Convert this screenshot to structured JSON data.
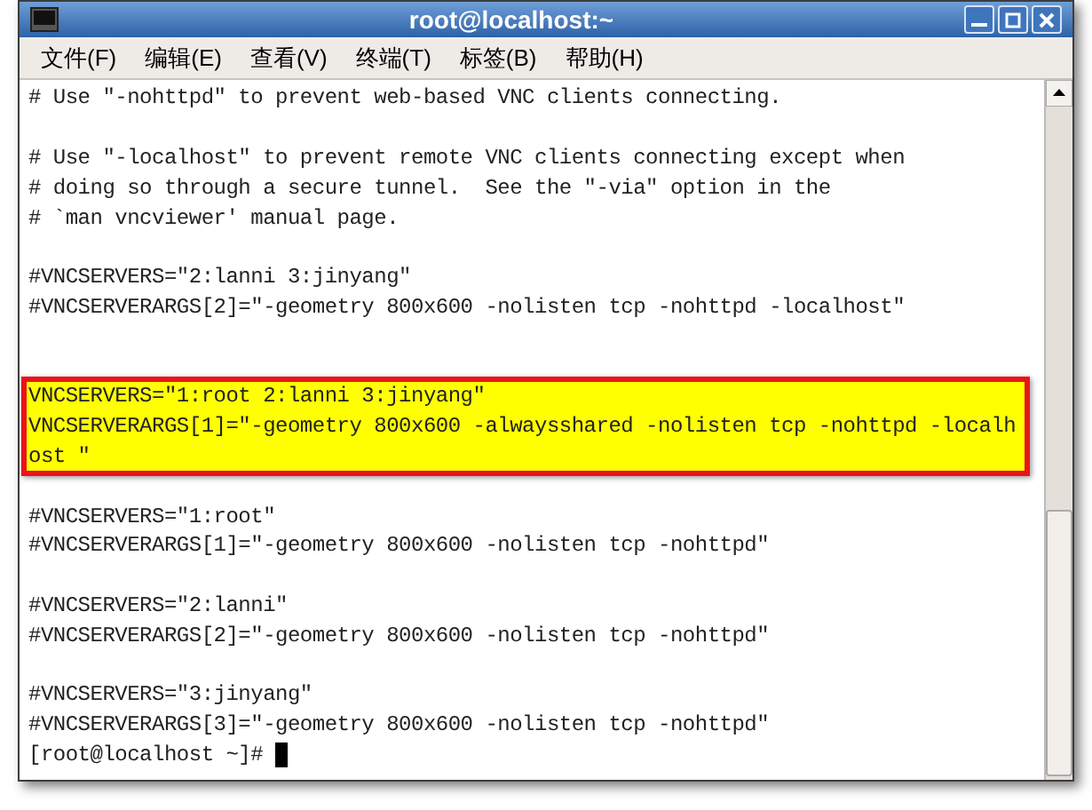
{
  "window": {
    "title": "root@localhost:~"
  },
  "menu": [
    "文件(F)",
    "编辑(E)",
    "查看(V)",
    "终端(T)",
    "标签(B)",
    "帮助(H)"
  ],
  "terminal": {
    "lines": [
      {
        "kind": "text",
        "text": "# Use \"-nohttpd\" to prevent web-based VNC clients connecting.",
        "highlighted": false
      },
      {
        "kind": "blank"
      },
      {
        "kind": "text",
        "text": "# Use \"-localhost\" to prevent remote VNC clients connecting except when",
        "highlighted": false
      },
      {
        "kind": "text",
        "text": "# doing so through a secure tunnel.  See the \"-via\" option in the",
        "highlighted": false
      },
      {
        "kind": "text",
        "text": "# `man vncviewer' manual page.",
        "highlighted": false
      },
      {
        "kind": "blank"
      },
      {
        "kind": "text",
        "text": "#VNCSERVERS=\"2:lanni 3:jinyang\"",
        "highlighted": false
      },
      {
        "kind": "text",
        "text": "#VNCSERVERARGS[2]=\"-geometry 800x600 -nolisten tcp -nohttpd -localhost\"",
        "highlighted": false
      },
      {
        "kind": "blank"
      },
      {
        "kind": "blank"
      },
      {
        "kind": "text",
        "text": "VNCSERVERS=\"1:root 2:lanni 3:jinyang\"",
        "highlighted": true
      },
      {
        "kind": "text",
        "text": "VNCSERVERARGS[1]=\"-geometry 800x600 -alwaysshared -nolisten tcp -nohttpd -localh",
        "highlighted": true
      },
      {
        "kind": "text",
        "text": "ost \"",
        "highlighted": true
      },
      {
        "kind": "blank"
      },
      {
        "kind": "text",
        "text": "#VNCSERVERS=\"1:root\"",
        "highlighted": false
      },
      {
        "kind": "text",
        "text": "#VNCSERVERARGS[1]=\"-geometry 800x600 -nolisten tcp -nohttpd\"",
        "highlighted": false
      },
      {
        "kind": "blank"
      },
      {
        "kind": "text",
        "text": "#VNCSERVERS=\"2:lanni\"",
        "highlighted": false
      },
      {
        "kind": "text",
        "text": "#VNCSERVERARGS[2]=\"-geometry 800x600 -nolisten tcp -nohttpd\"",
        "highlighted": false
      },
      {
        "kind": "blank"
      },
      {
        "kind": "text",
        "text": "#VNCSERVERS=\"3:jinyang\"",
        "highlighted": false
      },
      {
        "kind": "text",
        "text": "#VNCSERVERARGS[3]=\"-geometry 800x600 -nolisten tcp -nohttpd\"",
        "highlighted": false
      },
      {
        "kind": "prompt",
        "text": "[root@localhost ~]#"
      }
    ]
  }
}
